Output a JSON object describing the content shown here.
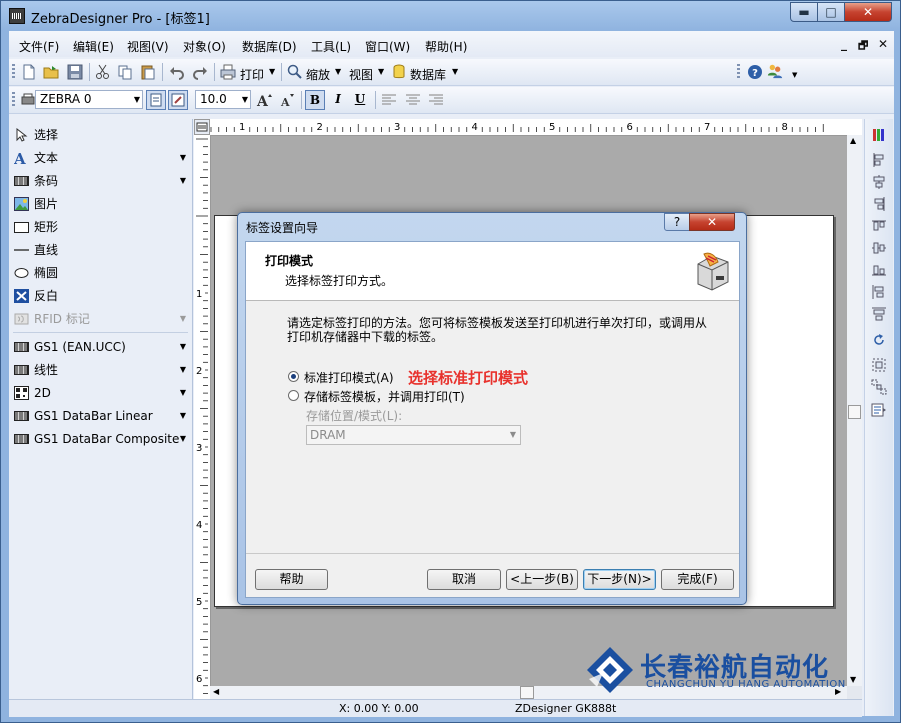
{
  "window": {
    "title": "ZebraDesigner Pro - [标签1]",
    "min_glyph": "▬",
    "max_glyph": "□",
    "close_glyph": "✕"
  },
  "menu": {
    "items": [
      "文件(F)",
      "编辑(E)",
      "视图(V)",
      "对象(O)",
      "数据库(D)",
      "工具(L)",
      "窗口(W)",
      "帮助(H)"
    ],
    "mdi_min": "_",
    "mdi_restore": "🗗",
    "mdi_close": "✕"
  },
  "toolbar1": {
    "print": "打印",
    "zoom": "缩放",
    "view": "视图",
    "database": "数据库"
  },
  "toolbar2": {
    "printer": "ZEBRA 0",
    "font_size": "10.0",
    "bold": "B",
    "italic": "I",
    "underline": "U"
  },
  "palette": {
    "items": [
      {
        "label": "选择"
      },
      {
        "label": "文本"
      },
      {
        "label": "条码"
      },
      {
        "label": "图片"
      },
      {
        "label": "矩形"
      },
      {
        "label": "直线"
      },
      {
        "label": "椭圆"
      },
      {
        "label": "反白"
      },
      {
        "label": "RFID 标记"
      },
      {
        "label": "GS1 (EAN.UCC)"
      },
      {
        "label": "线性"
      },
      {
        "label": "2D"
      },
      {
        "label": "GS1 DataBar Linear"
      },
      {
        "label": "GS1 DataBar Composite"
      }
    ]
  },
  "ruler": {
    "h_numbers": [
      "1",
      "2",
      "3",
      "4",
      "5",
      "6",
      "7",
      "8"
    ],
    "v_numbers": [
      "1",
      "2",
      "3",
      "4",
      "5",
      "6"
    ]
  },
  "status": {
    "xy": "X:  0.00 Y:  0.00",
    "printer": "ZDesigner GK888t"
  },
  "dialog": {
    "title": "标签设置向导",
    "help_glyph": "?",
    "close_glyph": "✕",
    "heading": "打印模式",
    "subheading": "选择标签打印方式。",
    "description": "请选定标签打印的方法。您可将标签模板发送至打印机进行单次打印，或调用从打印机存储器中下载的标签。",
    "option_standard": "标准打印模式(A)",
    "option_store": "存储标签模板，并调用打印(T)",
    "annotation": "选择标准打印模式",
    "storage_label": "存储位置/模式(L):",
    "storage_value": "DRAM",
    "buttons": {
      "help": "帮助",
      "cancel": "取消",
      "back": "<上一步(B)",
      "next": "下一步(N)>",
      "finish": "完成(F)"
    }
  },
  "watermark": {
    "cn": "长春裕航自动化",
    "en": "CHANGCHUN YU HANG AUTOMATION"
  },
  "colors": {
    "annotation": "#e8322d",
    "watermark": "#1a4fa0",
    "title_bar": "#8fb3df"
  }
}
